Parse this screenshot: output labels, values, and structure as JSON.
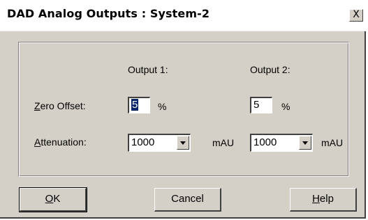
{
  "window": {
    "title": "DAD Analog Outputs : System-2",
    "close_glyph": "X"
  },
  "columns": {
    "output1": "Output 1:",
    "output2": "Output 2:"
  },
  "zero_offset": {
    "label_mnemonic": "Z",
    "label_rest": "ero Offset:",
    "output1_value": "5",
    "output2_value": "5",
    "unit": "%"
  },
  "attenuation": {
    "label_mnemonic": "A",
    "label_rest": "ttenuation:",
    "output1_value": "1000",
    "output2_value": "1000",
    "unit": "mAU"
  },
  "buttons": {
    "ok_mnemonic": "O",
    "ok_rest": "K",
    "cancel": "Cancel",
    "help_mnemonic": "H",
    "help_rest": "elp"
  },
  "icons": {
    "close": "close-icon",
    "dropdown": "chevron-down-icon"
  },
  "colors": {
    "dialog_face": "#d4d0c8",
    "selection": "#0a246a"
  }
}
